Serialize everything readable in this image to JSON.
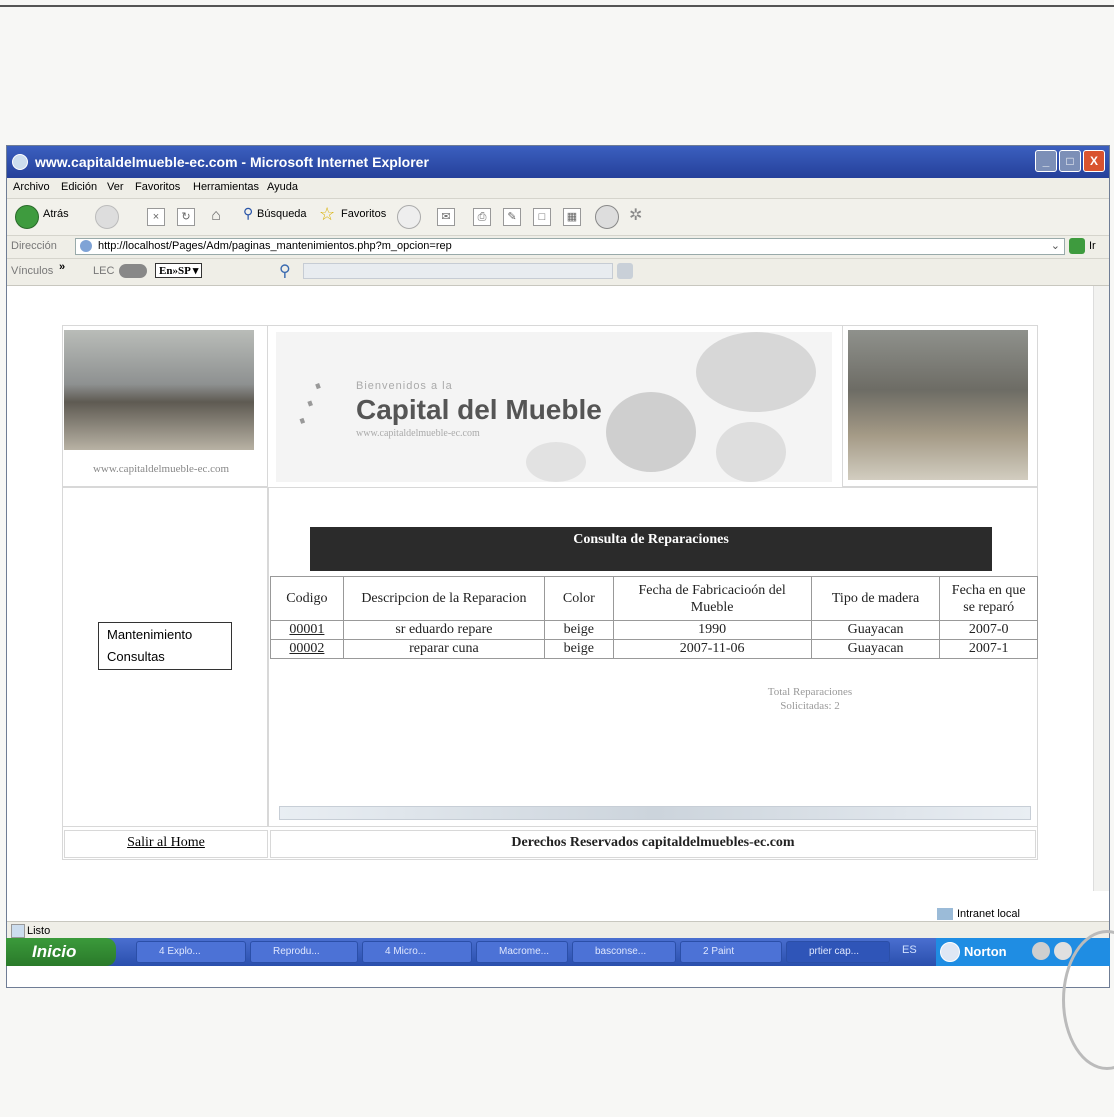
{
  "window": {
    "title": "www.capitaldelmueble-ec.com - Microsoft Internet Explorer",
    "buttons": {
      "minimize": "_",
      "maximize": "□",
      "close": "X"
    }
  },
  "menubar": {
    "items": [
      "Archivo",
      "Edición",
      "Ver",
      "Favoritos",
      "Herramientas",
      "Ayuda"
    ]
  },
  "toolbar": {
    "back_label": "Atrás",
    "search_label": "Búsqueda",
    "favorites_label": "Favoritos"
  },
  "address": {
    "label": "Dirección",
    "url": "http://localhost/Pages/Adm/paginas_mantenimientos.php?m_opcion=rep",
    "go_label": "Ir"
  },
  "links": {
    "label": "Vínculos",
    "lec_label": "LEC",
    "translate_label": "En»SP ▾"
  },
  "site": {
    "left_url": "www.capitaldelmueble-ec.com",
    "banner_welcome": "Bienvenidos a la",
    "banner_title": "Capital del Mueble",
    "banner_sub": "www.capitaldelmueble-ec.com"
  },
  "nav": {
    "items": [
      "Mantenimiento",
      "Consultas"
    ],
    "home_link": "Salir al Home"
  },
  "report": {
    "header": "Consulta de Reparaciones",
    "columns": [
      "Codigo",
      "Descripcion de la Reparacion",
      "Color",
      "Fecha de Fabricacioón del Mueble",
      "Tipo de madera",
      "Fecha en que se reparó"
    ],
    "rows": [
      [
        "00001",
        "sr eduardo repare",
        "beige",
        "1990",
        "Guayacan",
        "2007-0"
      ],
      [
        "00002",
        "reparar cuna",
        "beige",
        "2007-11-06",
        "Guayacan",
        "2007-1"
      ]
    ],
    "total_line1": "Total Reparaciones",
    "total_line2": "Solicitadas: 2"
  },
  "footer": {
    "copyright": "Derechos Reservados capitaldelmuebles-ec.com"
  },
  "statusbar": {
    "status": "Listo",
    "zone": "Intranet local"
  },
  "taskbar": {
    "start": "Inicio",
    "tasks": [
      "4 Explo...",
      "Reprodu...",
      "4 Micro...",
      "Macrome...",
      "basconse...",
      "2 Paint",
      "prtier cap..."
    ],
    "lang": "ES",
    "norton": "Norton"
  }
}
